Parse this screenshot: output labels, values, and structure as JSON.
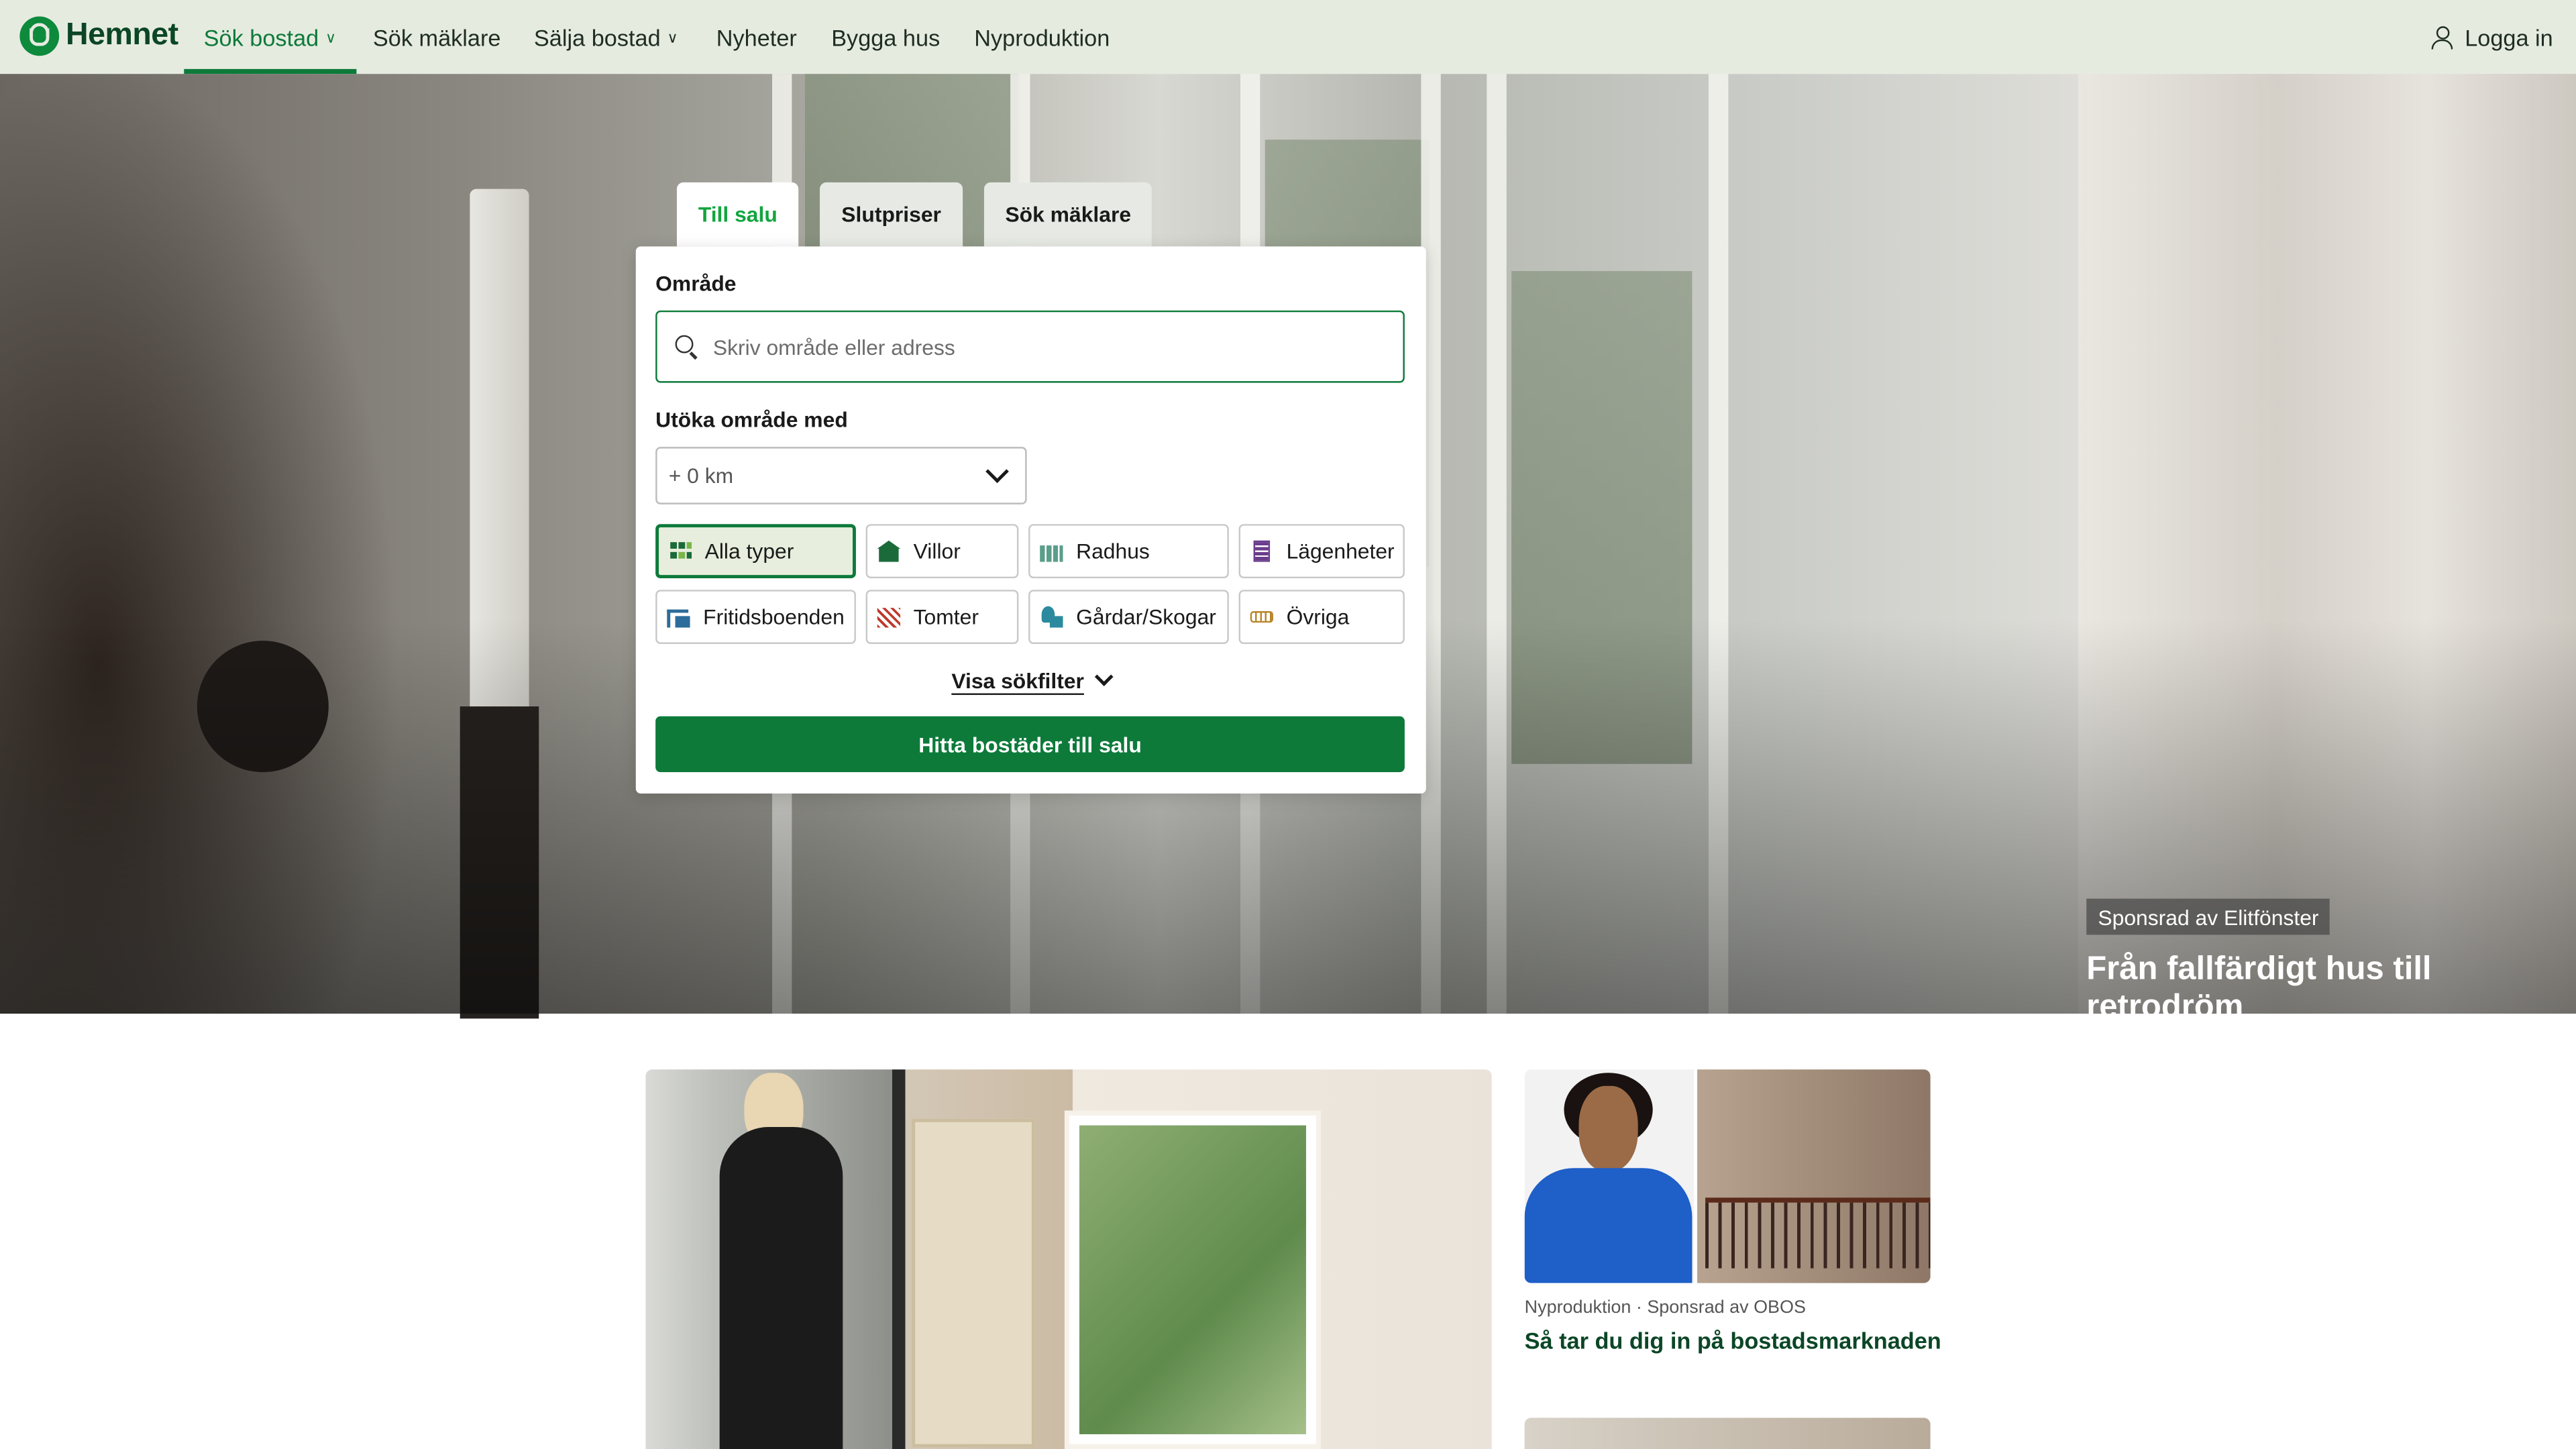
{
  "brand": {
    "name": "Hemnet",
    "color": "#0d7a3a"
  },
  "nav": {
    "items": [
      {
        "label": "Sök bostad",
        "has_dropdown": true,
        "active": true
      },
      {
        "label": "Sök mäklare",
        "has_dropdown": false
      },
      {
        "label": "Sälja bostad",
        "has_dropdown": true
      },
      {
        "label": "Nyheter",
        "has_dropdown": false
      },
      {
        "label": "Bygga hus",
        "has_dropdown": false
      },
      {
        "label": "Nyproduktion",
        "has_dropdown": false
      }
    ],
    "login_label": "Logga in",
    "login_icon": "user-icon"
  },
  "search": {
    "tabs": [
      {
        "label": "Till salu",
        "active": true
      },
      {
        "label": "Slutpriser"
      },
      {
        "label": "Sök mäklare"
      }
    ],
    "area_label": "Område",
    "area_placeholder": "Skriv område eller adress",
    "area_value": "",
    "expand_label": "Utöka område med",
    "expand_value": "+ 0 km",
    "types": [
      {
        "label": "Alla typer",
        "icon": "all-types-icon",
        "selected": true
      },
      {
        "label": "Villor",
        "icon": "villa-icon"
      },
      {
        "label": "Radhus",
        "icon": "townhouse-icon"
      },
      {
        "label": "Lägenheter",
        "icon": "apartment-icon"
      },
      {
        "label": "Fritidsboenden",
        "icon": "holiday-home-icon"
      },
      {
        "label": "Tomter",
        "icon": "plot-icon"
      },
      {
        "label": "Gårdar/Skogar",
        "icon": "farm-forest-icon"
      },
      {
        "label": "Övriga",
        "icon": "other-icon"
      }
    ],
    "filters_link": "Visa sökfilter",
    "submit_label": "Hitta bostäder till salu"
  },
  "hero": {
    "sponsor_tag": "Sponsrad av Elitfönster",
    "headline": "Från fallfärdigt hus till retrodröm"
  },
  "articles": {
    "side": {
      "meta": "Nyproduktion · Sponsrad av OBOS",
      "title": "Så tar du dig in på bostadsmarknaden"
    }
  }
}
